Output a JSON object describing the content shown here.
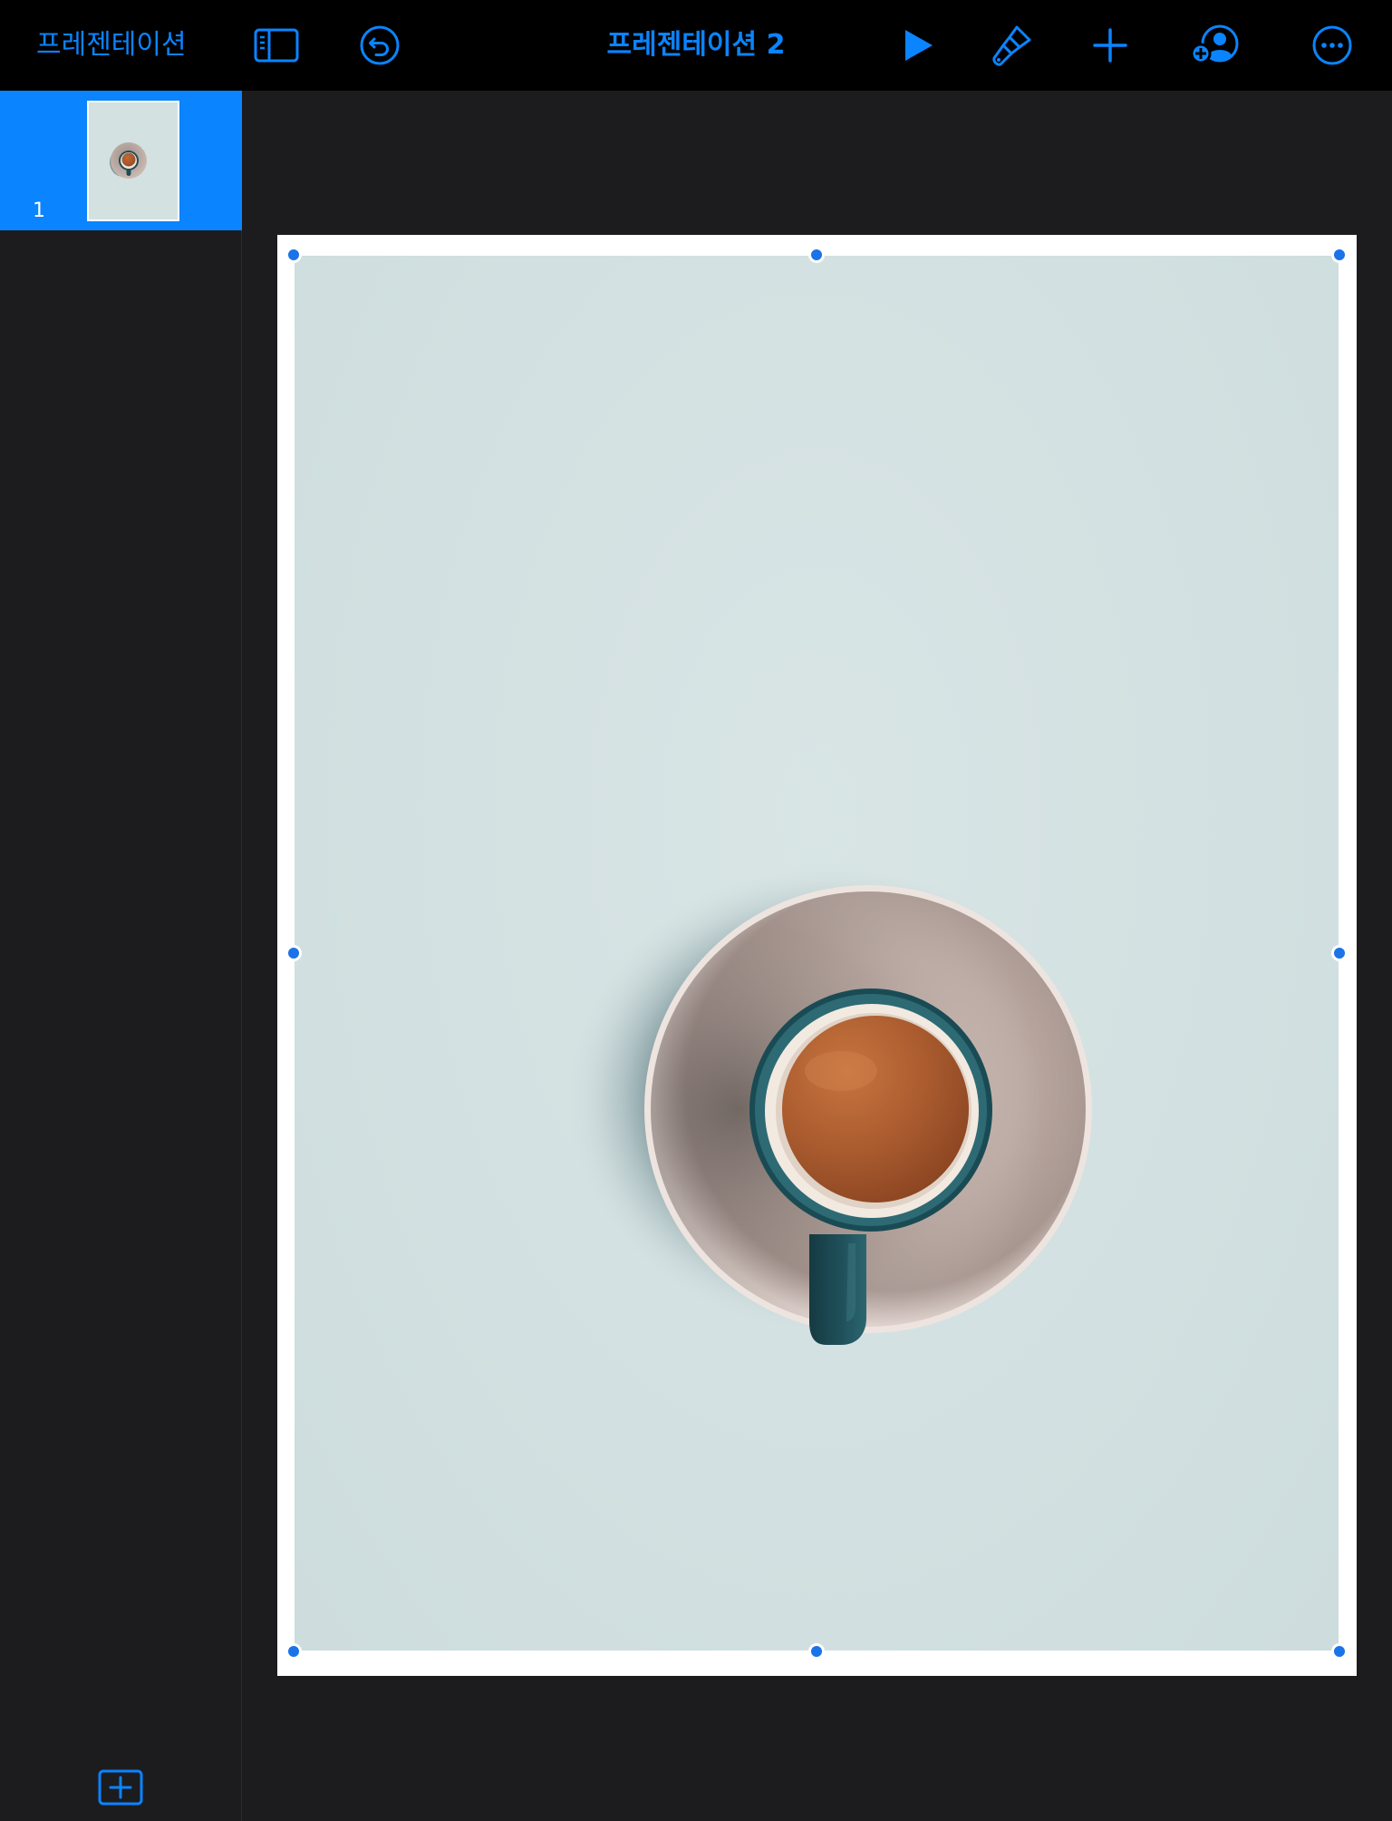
{
  "toolbar": {
    "back_label": "프레젠테이션",
    "document_title": "프레젠테이션 2",
    "icons": {
      "sidebar_toggle": "sidebar-toggle-icon",
      "undo": "undo-icon",
      "play": "play-icon",
      "format": "paintbrush-icon",
      "insert": "plus-icon",
      "collaborate": "add-person-icon",
      "more": "ellipsis-circle-icon"
    }
  },
  "navigator": {
    "slides": [
      {
        "number": "1",
        "selected": true
      }
    ],
    "add_slide_icon": "add-slide-icon"
  },
  "colors": {
    "accent": "#0a84ff",
    "toolbar_bg": "#000000",
    "app_bg": "#1c1c1e",
    "selection_handle": "#1a73e8",
    "photo_bg": "#d3e1e1"
  }
}
